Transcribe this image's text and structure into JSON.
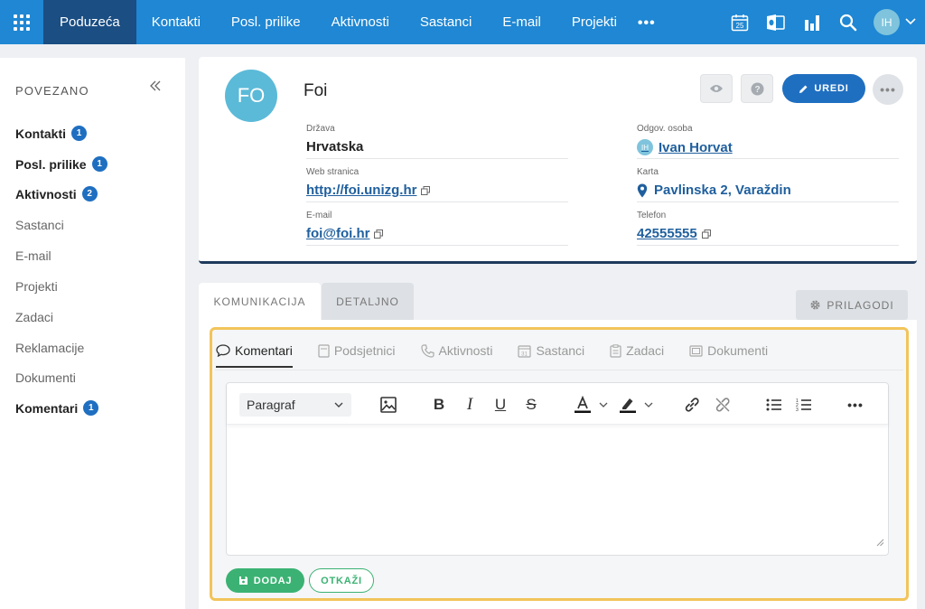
{
  "nav": {
    "items": [
      {
        "label": "Poduzeća",
        "active": true
      },
      {
        "label": "Kontakti"
      },
      {
        "label": "Posl. prilike"
      },
      {
        "label": "Aktivnosti"
      },
      {
        "label": "Sastanci"
      },
      {
        "label": "E-mail"
      },
      {
        "label": "Projekti"
      }
    ],
    "more": "•••",
    "calendar_day": "25",
    "user_initials": "IH"
  },
  "sidebar": {
    "title": "POVEZANO",
    "items": [
      {
        "label": "Kontakti",
        "badge": "1"
      },
      {
        "label": "Posl. prilike",
        "badge": "1"
      },
      {
        "label": "Aktivnosti",
        "badge": "2"
      },
      {
        "label": "Sastanci"
      },
      {
        "label": "E-mail"
      },
      {
        "label": "Projekti"
      },
      {
        "label": "Zadaci"
      },
      {
        "label": "Reklamacije"
      },
      {
        "label": "Dokumenti"
      },
      {
        "label": "Komentari",
        "badge": "1"
      }
    ]
  },
  "record": {
    "initials": "FO",
    "name": "Foi",
    "edit_label": "UREDI",
    "fields_left": [
      {
        "label": "Država",
        "value": "Hrvatska"
      },
      {
        "label": "Web stranica",
        "value": "http://foi.unizg.hr"
      },
      {
        "label": "E-mail",
        "value": "foi@foi.hr"
      }
    ],
    "fields_right": [
      {
        "label": "Odgov. osoba",
        "value": "Ivan Horvat",
        "initials": "IH"
      },
      {
        "label": "Karta",
        "value": "Pavlinska 2, Varaždin"
      },
      {
        "label": "Telefon",
        "value": "42555555"
      }
    ]
  },
  "tabs": {
    "items": [
      {
        "label": "KOMUNIKACIJA",
        "active": true
      },
      {
        "label": "DETALJNO"
      }
    ],
    "customize_label": "PRILAGODI"
  },
  "comm": {
    "subtabs": [
      {
        "label": "Komentari",
        "active": true
      },
      {
        "label": "Podsjetnici"
      },
      {
        "label": "Aktivnosti"
      },
      {
        "label": "Sastanci"
      },
      {
        "label": "Zadaci"
      },
      {
        "label": "Dokumenti"
      }
    ],
    "editor": {
      "paragraph": "Paragraf"
    },
    "add_label": "DODAJ",
    "cancel_label": "OTKAŽI"
  },
  "colors": {
    "nav_bg": "#1f87d3",
    "nav_active": "#1b4e83",
    "accent_blue": "#1f6fc1",
    "success": "#3bb273",
    "highlight": "#f2c45a"
  }
}
